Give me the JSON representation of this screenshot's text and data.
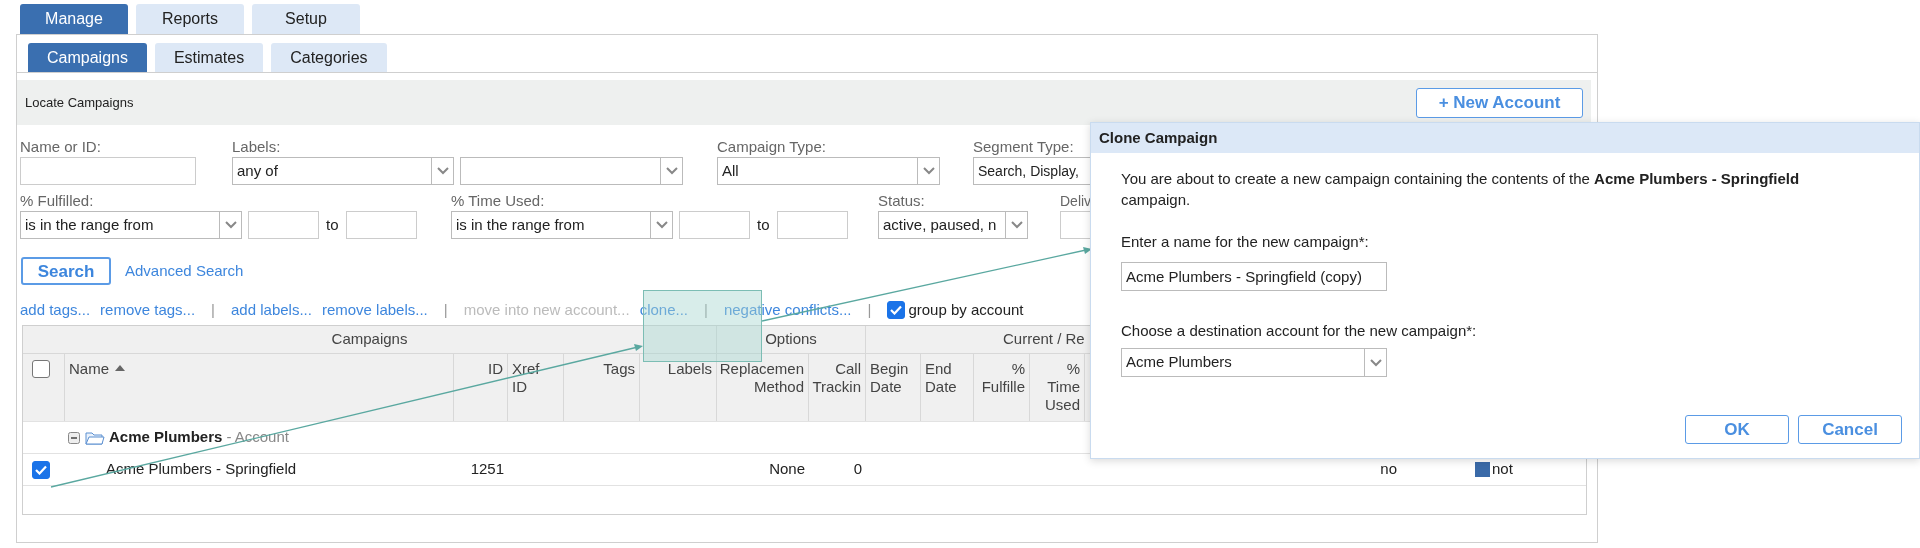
{
  "top_tabs": [
    {
      "label": "Manage",
      "selected": true
    },
    {
      "label": "Reports",
      "selected": false
    },
    {
      "label": "Setup",
      "selected": false
    }
  ],
  "sub_tabs": [
    {
      "label": "Campaigns",
      "selected": true
    },
    {
      "label": "Estimates",
      "selected": false
    },
    {
      "label": "Categories",
      "selected": false
    }
  ],
  "panel_title": "Locate Campaigns",
  "new_account_button": "+ New Account",
  "filter_rows": [
    [
      {
        "kind": "text",
        "label": "Name or ID:"
      },
      {
        "kind": "double_select",
        "label": "Labels:",
        "value": "any of"
      },
      {
        "kind": "select",
        "label": "Campaign Type:",
        "value": "All"
      },
      {
        "kind": "select_cut",
        "label": "Segment Type:",
        "value": "Search, Display,"
      }
    ],
    [
      {
        "kind": "range",
        "label": "% Fulfilled:",
        "value": "is in the range from",
        "to": "to"
      },
      {
        "kind": "range",
        "label": "% Time Used:",
        "value": "is in the range from",
        "to": "to"
      },
      {
        "kind": "select",
        "label": "Status:",
        "value": "active, paused, n"
      },
      {
        "kind": "text_cut",
        "label": "Deliv"
      }
    ]
  ],
  "search_button": "Search",
  "advanced_search_link": "Advanced Search",
  "actions": [
    {
      "kind": "link",
      "label": "add tags...",
      "disabled": false
    },
    {
      "kind": "link",
      "label": "remove tags...",
      "disabled": false
    },
    {
      "kind": "separator",
      "label": "|"
    },
    {
      "kind": "link",
      "label": "add labels...",
      "disabled": false
    },
    {
      "kind": "link",
      "label": "remove labels...",
      "disabled": false
    },
    {
      "kind": "separator",
      "label": "|"
    },
    {
      "kind": "link",
      "label": "move into new account...",
      "disabled": true
    },
    {
      "kind": "link",
      "label": "clone...",
      "disabled": false
    },
    {
      "kind": "separator",
      "label": "|"
    },
    {
      "kind": "link",
      "label": "negative conflicts...",
      "disabled": false
    },
    {
      "kind": "separator",
      "label": "|"
    },
    {
      "kind": "checkbox",
      "label": "group by account",
      "checked": true
    }
  ],
  "table": {
    "column_groups": [
      {
        "label": "Campaigns"
      },
      {
        "label": "Options"
      },
      {
        "label": "Current / Re"
      }
    ],
    "select_all_checked": false,
    "columns": [
      {
        "label": "Name",
        "sort_ascending": true
      },
      {
        "label": "ID"
      },
      {
        "label": "Xref ID"
      },
      {
        "label": "Tags"
      },
      {
        "label": "Labels"
      },
      {
        "label": "Replacemen Method"
      },
      {
        "label": "Call Trackin"
      },
      {
        "label": "Begin Date"
      },
      {
        "label": "End Date"
      },
      {
        "label": "% Fulfille"
      },
      {
        "label": "% Time Used"
      }
    ],
    "groups": [
      {
        "name": "Acme Plumbers",
        "suffix": "- Account",
        "expanded": true,
        "rows": [
          {
            "checked": true,
            "name": "Acme Plumbers - Springfield",
            "id": "1251",
            "replacement_method": "None",
            "call_tracking": "0",
            "column_14": "no",
            "column_16": "not"
          }
        ]
      }
    ]
  },
  "dialog": {
    "title": "Clone Campaign",
    "message": "You are about to create a new campaign containing the contents of the **Acme Plumbers - Springfield** campaign.",
    "name_label": "Enter a name for the new campaign*:",
    "name_value": "Acme Plumbers - Springfield (copy)",
    "account_label": "Choose a destination account for the new campaign*:",
    "account_value": "Acme Plumbers",
    "buttons": [
      "OK",
      "Cancel"
    ]
  }
}
